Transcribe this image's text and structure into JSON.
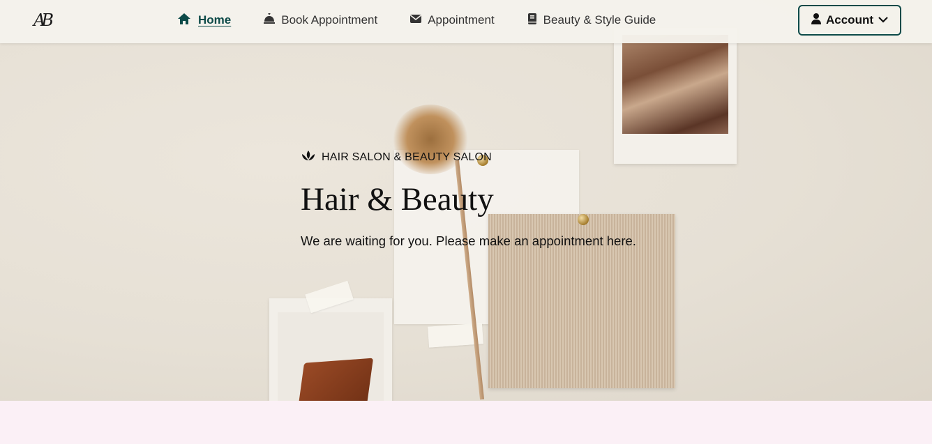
{
  "header": {
    "logo_text": "AB",
    "nav": [
      {
        "label": "Home",
        "icon": "home-icon",
        "active": true
      },
      {
        "label": "Book Appointment",
        "icon": "service-bell-icon",
        "active": false
      },
      {
        "label": "Appointment",
        "icon": "envelope-icon",
        "active": false
      },
      {
        "label": "Beauty & Style Guide",
        "icon": "book-icon",
        "active": false
      }
    ],
    "account_label": "Account"
  },
  "hero": {
    "kicker": "HAIR SALON & BEAUTY SALON",
    "title": "Hair & Beauty",
    "subtitle": "We are waiting for you. Please make an appointment here."
  },
  "colors": {
    "accent": "#0c4a48",
    "header_bg": "#f5f2ec",
    "hero_bg": "#e6e0d5",
    "bottom_band": "#fbf0f6",
    "text": "#111111"
  }
}
